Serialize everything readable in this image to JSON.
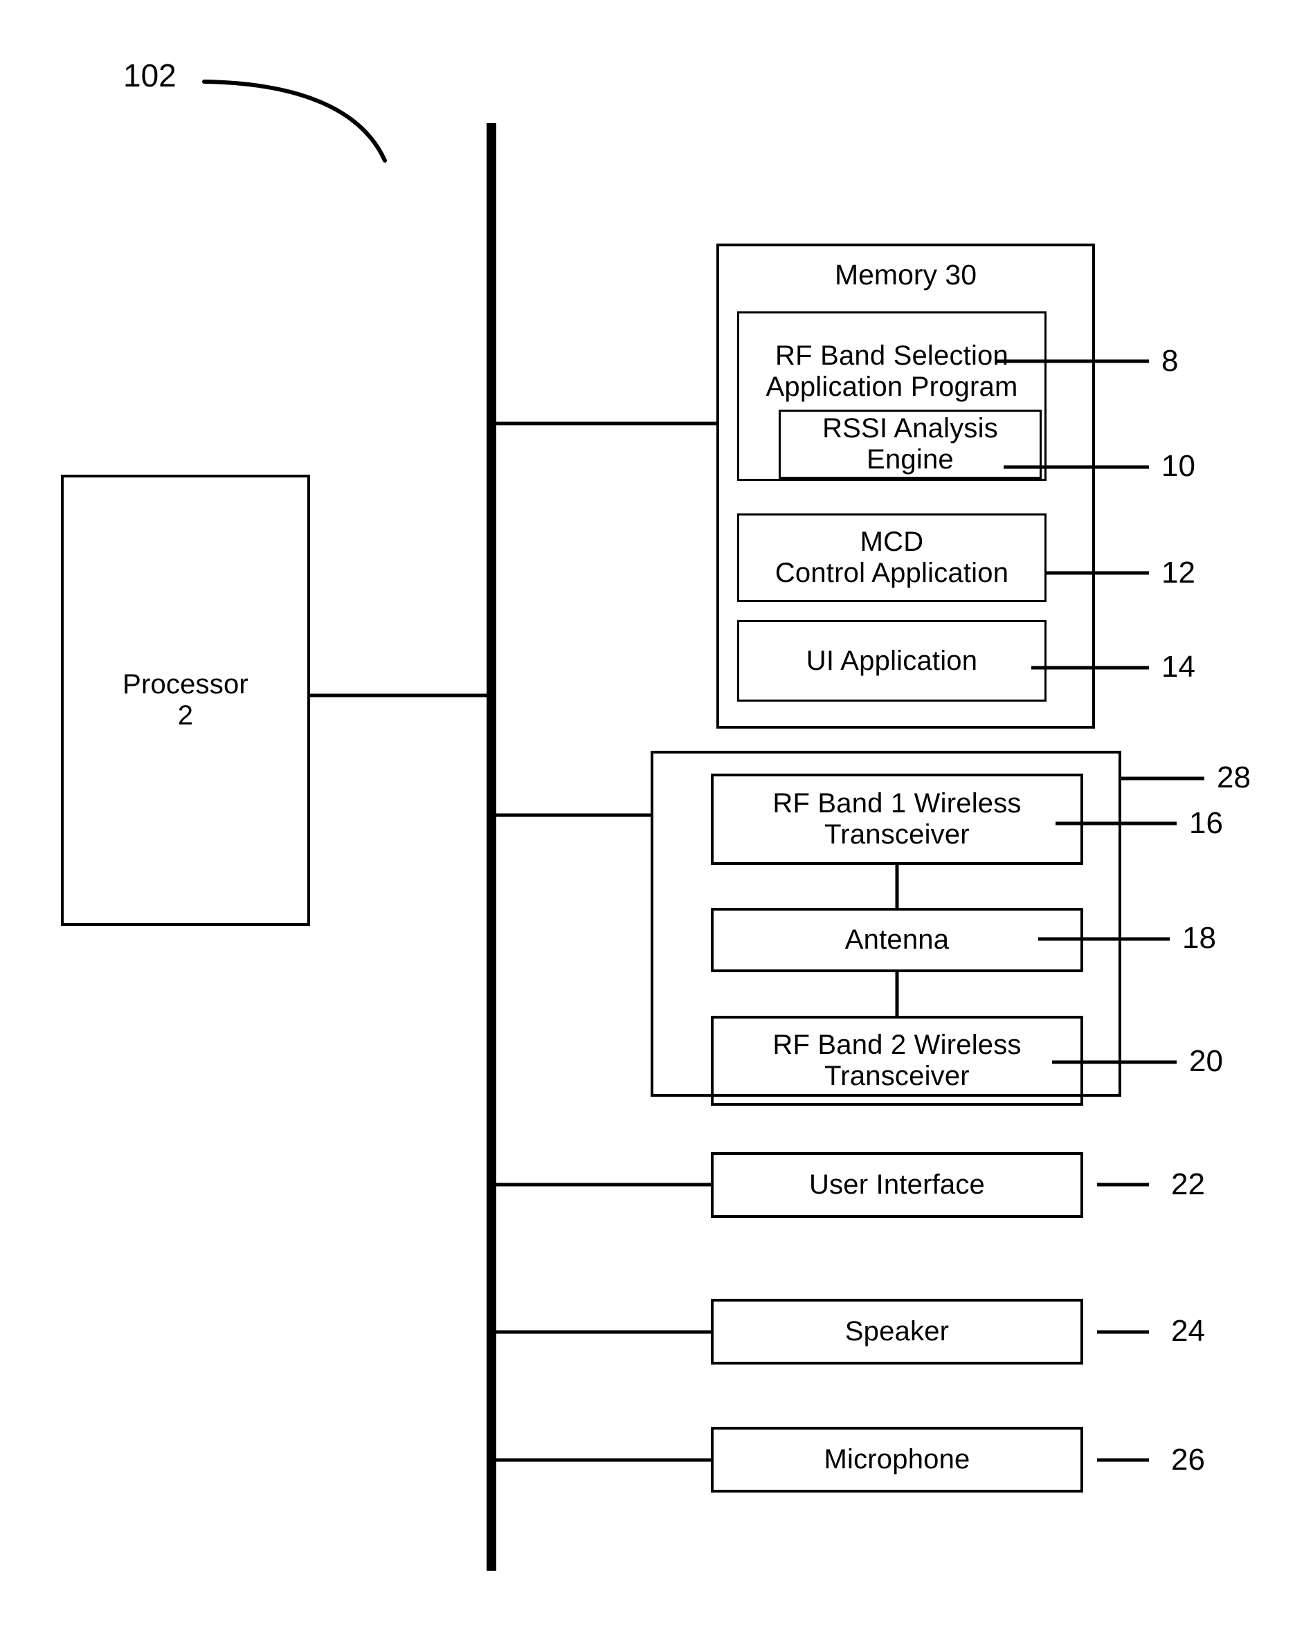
{
  "figure": {
    "figure_reference": "102",
    "processor": {
      "label_line1": "Processor",
      "label_line2": "2"
    },
    "memory_group": {
      "title": "Memory 30",
      "ref": "30",
      "items": [
        {
          "id": "rf-band-selection",
          "label_line1": "RF Band Selection",
          "label_line2": "Application Program",
          "ref": "8"
        },
        {
          "id": "rssi-analysis-engine",
          "label_line1": "RSSI Analysis",
          "label_line2": "Engine",
          "ref": "10"
        },
        {
          "id": "mcd-control-application",
          "label_line1": "MCD",
          "label_line2": "Control Application",
          "ref": "12"
        },
        {
          "id": "ui-application",
          "label_line1": "UI Application",
          "label_line2": "",
          "ref": "14"
        }
      ]
    },
    "radio_group": {
      "ref": "28",
      "items": [
        {
          "id": "rf-band-1-transceiver",
          "label_line1": "RF Band 1 Wireless",
          "label_line2": "Transceiver",
          "ref": "16"
        },
        {
          "id": "antenna",
          "label_line1": "Antenna",
          "label_line2": "",
          "ref": "18"
        },
        {
          "id": "rf-band-2-transceiver",
          "label_line1": "RF Band 2 Wireless",
          "label_line2": "Transceiver",
          "ref": "20"
        }
      ]
    },
    "peripherals": [
      {
        "id": "user-interface",
        "label": "User Interface",
        "ref": "22"
      },
      {
        "id": "speaker",
        "label": "Speaker",
        "ref": "24"
      },
      {
        "id": "microphone",
        "label": "Microphone",
        "ref": "26"
      }
    ],
    "colors": {
      "ink": "#000000",
      "paper": "#ffffff"
    }
  }
}
